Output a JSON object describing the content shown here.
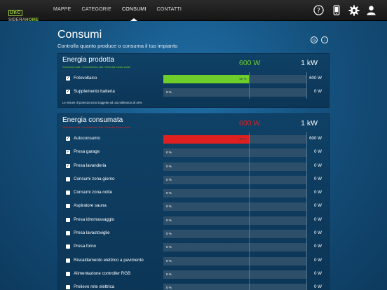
{
  "header": {
    "logo_box": "UnC",
    "logo_brand_a": "SIDERA",
    "logo_brand_b": "HOME",
    "nav": [
      "MAPPE",
      "CATEGORIE",
      "CONSUMI",
      "CONTATTI"
    ],
    "active_nav": 2,
    "icons": [
      "help-icon",
      "phone-icon",
      "gear-icon",
      "user-icon"
    ]
  },
  "page": {
    "title": "Consumi",
    "subtitle": "Controlla quanto produce o consuma il tuo impianto",
    "actions": [
      "clock-icon",
      "arrow-down-icon"
    ]
  },
  "produced": {
    "title": "Energia prodotta",
    "links": "Seleziona tutti / Deseleziona tutti / Resetta fondo scala",
    "total": "600 W",
    "scale": "1 kW",
    "color": "#6fcf2a",
    "note": "Le misure di potenza sono soggette ad una tolleranza di ±5%",
    "rows": [
      {
        "label": "Fotovoltaico",
        "checked": true,
        "percent": 60,
        "pct_label": "60 %",
        "value": "600 W"
      },
      {
        "label": "Supplemento batteria",
        "checked": true,
        "percent": 0,
        "pct_label": "0 %",
        "value": "0 W"
      }
    ]
  },
  "consumed": {
    "title": "Energia consumata",
    "links": "Seleziona tutti / Deseleziona tutti / Resetta fondo scala",
    "total": "600 W",
    "scale": "1 kW",
    "color": "#e02020",
    "rows": [
      {
        "label": "Autoconsumo",
        "checked": true,
        "percent": 60,
        "pct_label": "60 %",
        "value": "600 W"
      },
      {
        "label": "Presa garage",
        "checked": true,
        "percent": 0,
        "pct_label": "0 %",
        "value": "0 W"
      },
      {
        "label": "Presa lavanderia",
        "checked": true,
        "percent": 0,
        "pct_label": "0 %",
        "value": "0 W"
      },
      {
        "label": "Consumi zona giorno",
        "checked": false,
        "percent": 0,
        "pct_label": "0 %",
        "value": "0 W"
      },
      {
        "label": "Consumi zona notte",
        "checked": false,
        "percent": 0,
        "pct_label": "0 %",
        "value": "0 W"
      },
      {
        "label": "Aspiratore sauna",
        "checked": false,
        "percent": 0,
        "pct_label": "0 %",
        "value": "0 W"
      },
      {
        "label": "Presa idromassaggio",
        "checked": false,
        "percent": 0,
        "pct_label": "0 %",
        "value": "0 W"
      },
      {
        "label": "Presa lavastoviglie",
        "checked": false,
        "percent": 0,
        "pct_label": "0 %",
        "value": "0 W"
      },
      {
        "label": "Presa forno",
        "checked": false,
        "percent": 0,
        "pct_label": "0 %",
        "value": "0 W"
      },
      {
        "label": "Riscaldamento elettrico a pavimento",
        "checked": false,
        "percent": 0,
        "pct_label": "0 %",
        "value": "0 W"
      },
      {
        "label": "Alimentazione controller RGB",
        "checked": false,
        "percent": 0,
        "pct_label": "0 %",
        "value": "0 W"
      },
      {
        "label": "Prelievo rete elettrica",
        "checked": false,
        "percent": 0,
        "pct_label": "0 %",
        "value": "0 W"
      }
    ]
  }
}
